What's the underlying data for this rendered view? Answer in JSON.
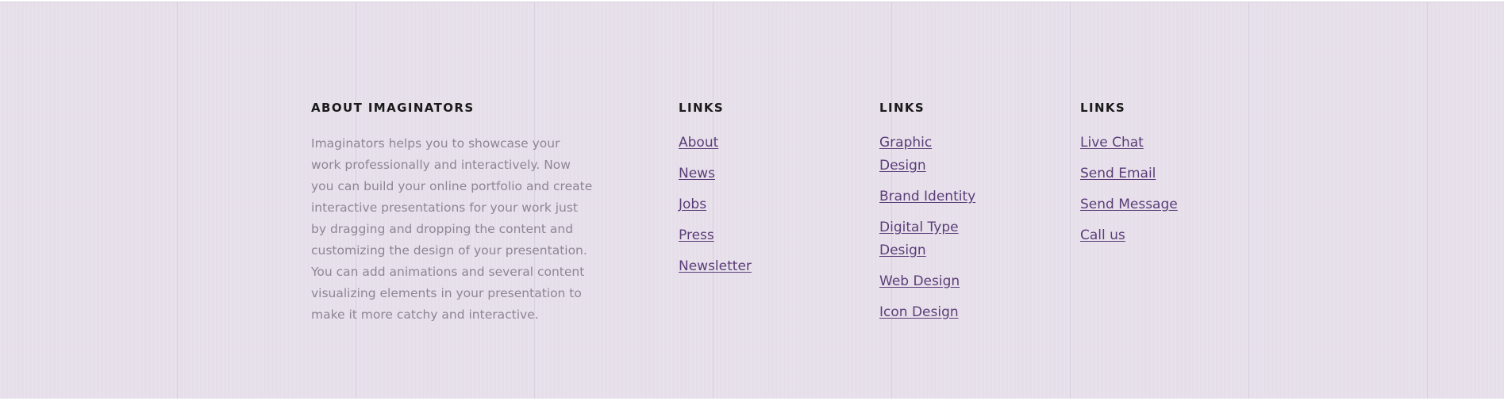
{
  "footer": {
    "about": {
      "heading": "ABOUT IMAGINATORS",
      "text": "Imaginators helps you to showcase your work professionally and interactively. Now you can build your online portfolio and create interactive presentations for your work just by dragging and dropping the content and customizing the design of your presentation. You can add animations and several content visualizing elements in your presentation to make it more catchy and interactive."
    },
    "columns": [
      {
        "heading": "LINKS",
        "links": [
          "About",
          "News",
          "Jobs",
          "Press",
          "Newsletter"
        ]
      },
      {
        "heading": "LINKS",
        "links": [
          "Graphic Design",
          "Brand Identity",
          "Digital Type Design",
          "Web Design",
          "Icon Design"
        ]
      },
      {
        "heading": "LINKS",
        "links": [
          "Live Chat",
          "Send Email",
          "Send Message",
          "Call us"
        ]
      }
    ],
    "colors": {
      "background": "#e6dfea",
      "heading": "#1a1a1a",
      "body_text": "#8f8594",
      "link": "#5a3d78"
    }
  }
}
